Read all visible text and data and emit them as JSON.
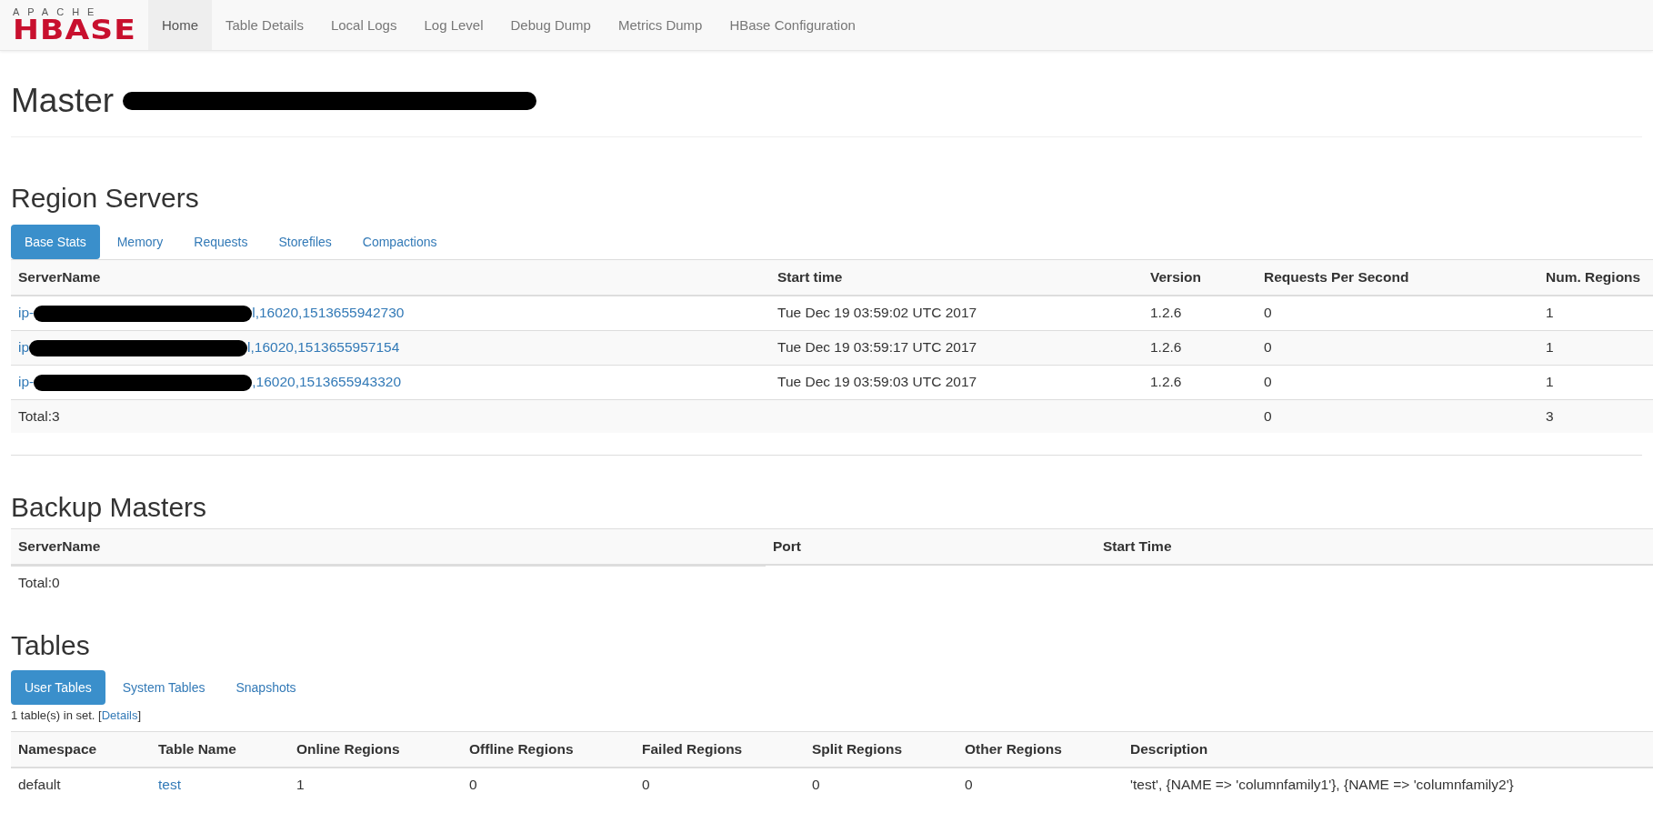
{
  "navbar": {
    "logo": {
      "top": "APACHE",
      "main": "HBASE"
    },
    "items": [
      {
        "label": "Home",
        "selected": true
      },
      {
        "label": "Table Details",
        "selected": false
      },
      {
        "label": "Local Logs",
        "selected": false
      },
      {
        "label": "Log Level",
        "selected": false
      },
      {
        "label": "Debug Dump",
        "selected": false
      },
      {
        "label": "Metrics Dump",
        "selected": false
      },
      {
        "label": "HBase Configuration",
        "selected": false
      }
    ]
  },
  "title": {
    "label": "Master",
    "redacted": true
  },
  "region_servers": {
    "heading": "Region Servers",
    "tabs": [
      {
        "label": "Base Stats",
        "selected": true
      },
      {
        "label": "Memory",
        "selected": false
      },
      {
        "label": "Requests",
        "selected": false
      },
      {
        "label": "Storefiles",
        "selected": false
      },
      {
        "label": "Compactions",
        "selected": false
      }
    ],
    "columns": [
      "ServerName",
      "Start time",
      "Version",
      "Requests Per Second",
      "Num. Regions"
    ],
    "rows": [
      {
        "server": {
          "prefix": "ip-",
          "suffix": "l,16020,1513655942730"
        },
        "start_time": "Tue Dec 19 03:59:02 UTC 2017",
        "version": "1.2.6",
        "requests": "0",
        "regions": "1"
      },
      {
        "server": {
          "prefix": "ip",
          "suffix": "l,16020,1513655957154"
        },
        "start_time": "Tue Dec 19 03:59:17 UTC 2017",
        "version": "1.2.6",
        "requests": "0",
        "regions": "1"
      },
      {
        "server": {
          "prefix": "ip-",
          "suffix": ",16020,1513655943320"
        },
        "start_time": "Tue Dec 19 03:59:03 UTC 2017",
        "version": "1.2.6",
        "requests": "0",
        "regions": "1"
      }
    ],
    "total": {
      "label": "Total:3",
      "requests": "0",
      "regions": "3"
    }
  },
  "backup_masters": {
    "heading": "Backup Masters",
    "columns": [
      "ServerName",
      "Port",
      "Start Time"
    ],
    "total": "Total:0"
  },
  "tables": {
    "heading": "Tables",
    "tabs": [
      {
        "label": "User Tables",
        "selected": true
      },
      {
        "label": "System Tables",
        "selected": false
      },
      {
        "label": "Snapshots",
        "selected": false
      }
    ],
    "summary": "1 table(s) in set. [",
    "details_link": "Details",
    "summary_end": "]",
    "columns": [
      "Namespace",
      "Table Name",
      "Online Regions",
      "Offline Regions",
      "Failed Regions",
      "Split Regions",
      "Other Regions",
      "Description"
    ],
    "rows": [
      {
        "namespace": "default",
        "name": "test",
        "online": "1",
        "offline": "0",
        "failed": "0",
        "split": "0",
        "other": "0",
        "description": "'test', {NAME => 'columnfamily1'}, {NAME => 'columnfamily2'}"
      }
    ]
  }
}
